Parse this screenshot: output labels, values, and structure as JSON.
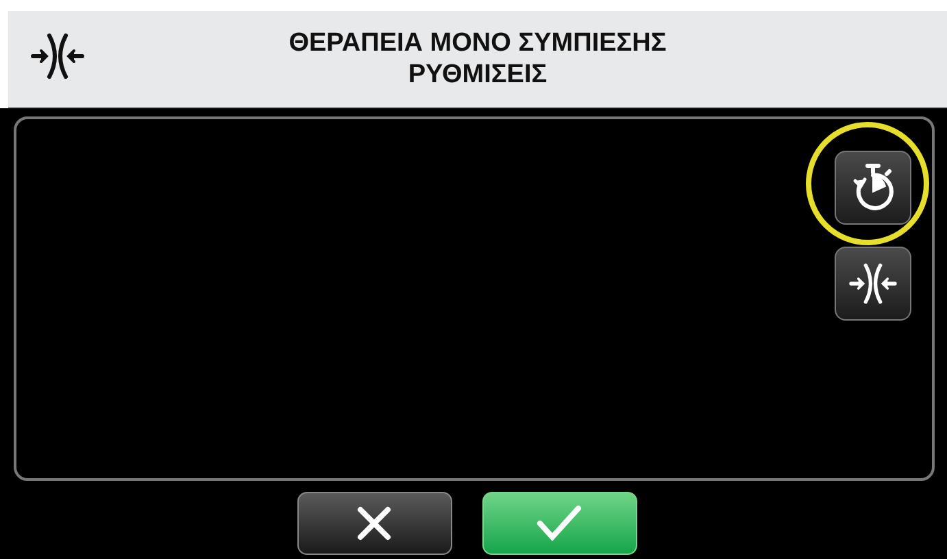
{
  "header": {
    "title_lines": [
      "ΘΕΡΑΠΕΙΑ ΜΟΝΟ ΣΥΜΠΙΕΣΗΣ",
      "ΡΥΘΜΙΣΕΙΣ"
    ]
  },
  "side_buttons": [
    {
      "kind": "timer",
      "highlighted": true
    },
    {
      "kind": "compression",
      "highlighted": false
    }
  ],
  "footer_buttons": [
    {
      "kind": "cancel"
    },
    {
      "kind": "confirm"
    }
  ]
}
